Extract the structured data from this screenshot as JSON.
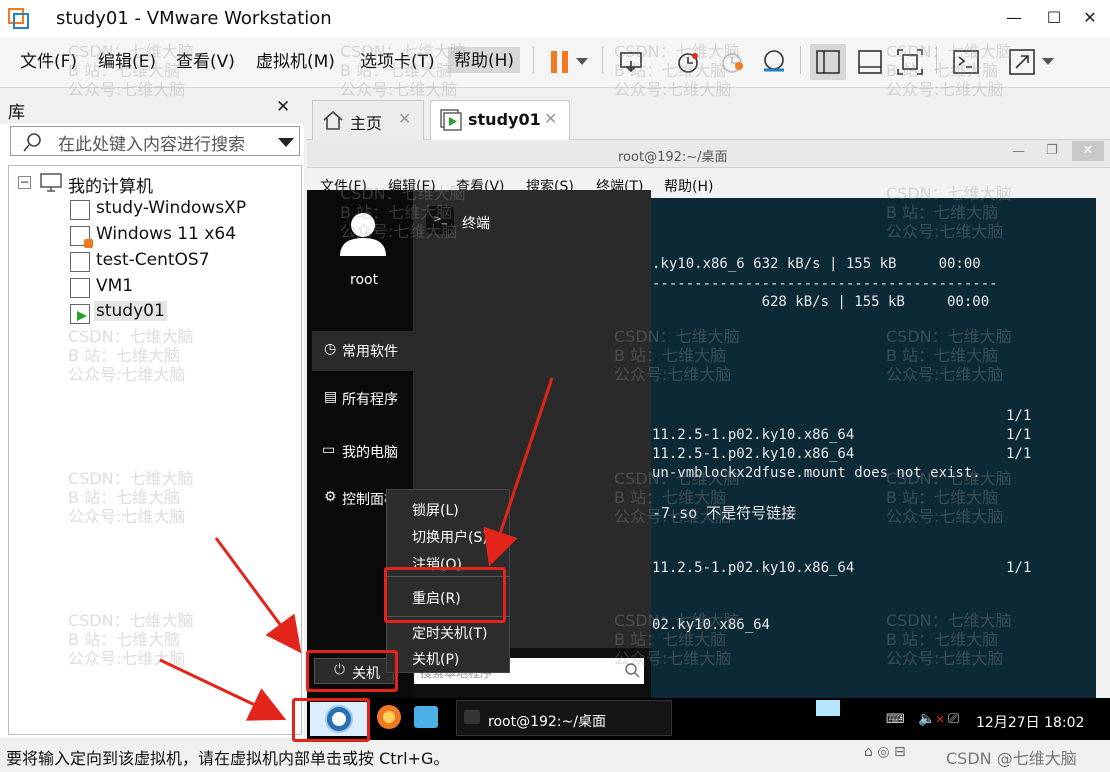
{
  "window": {
    "title": "study01 - VMware Workstation"
  },
  "menubar": {
    "items": [
      "文件(F)",
      "编辑(E)",
      "查看(V)",
      "虚拟机(M)",
      "选项卡(T)",
      "帮助(H)"
    ]
  },
  "toolbar": {
    "icons": [
      "pause-icon",
      "dropdown-icon",
      "snapshot-icon",
      "revert-icon",
      "snapshot-manager-icon",
      "library-view-icon",
      "thumbnail-view-icon",
      "fullscreen-icon",
      "console-icon",
      "stretch-icon"
    ]
  },
  "library": {
    "title": "库",
    "search_placeholder": "在此处键入内容进行搜索",
    "tree": {
      "root": "我的计算机",
      "items": [
        "study-WindowsXP",
        "Windows 11 x64",
        "test-CentOS7",
        "VM1",
        "study01"
      ]
    }
  },
  "tabs": [
    {
      "label": "主页"
    },
    {
      "label": "study01"
    }
  ],
  "guest": {
    "window_title": "root@192:~/桌面",
    "menu": [
      "文件(F)",
      "编辑(E)",
      "查看(V)",
      "搜索(S)",
      "终端(T)",
      "帮助(H)"
    ],
    "terminal_lines": [
      ".ky10.x86_6 632 kB/s | 155 kB     00:00",
      "-----------------------------------------",
      "             628 kB/s | 155 kB     00:00",
      "                                          1/1",
      "11.2.5-1.p02.ky10.x86_64                  1/1",
      "11.2.5-1.p02.ky10.x86_64                  1/1",
      "un-vmblockx2dfuse.mount does not exist.",
      "-7.so 不是符号链接",
      "11.2.5-1.p02.ky10.x86_64                  1/1",
      "02.ky10.x86_64"
    ],
    "start_menu": {
      "user": "root",
      "left_items": [
        "常用软件",
        "所有程序",
        "我的电脑",
        "控制面板"
      ],
      "app": "终端",
      "power_button": "关机",
      "search_placeholder": "搜索本地程序"
    },
    "power_menu": [
      "锁屏(L)",
      "切换用户(S)",
      "注销(O)",
      "重启(R)",
      "定时关机(T)",
      "关机(P)"
    ],
    "taskbar": {
      "task_label": "root@192:~/桌面",
      "clock": "12月27日 18:02"
    }
  },
  "status_bar": {
    "text": "要将输入定向到该虚拟机，请在虚拟机内部单击或按 Ctrl+G。",
    "right_text": "CSDN @七维大脑"
  },
  "watermark": [
    "CSDN：七维大脑",
    "B 站：七维大脑",
    "公众号:七维大脑"
  ],
  "colors": {
    "accent_red": "#e3241b",
    "pause_orange": "#f07a21",
    "terminal_bg": "#0c2a36"
  }
}
